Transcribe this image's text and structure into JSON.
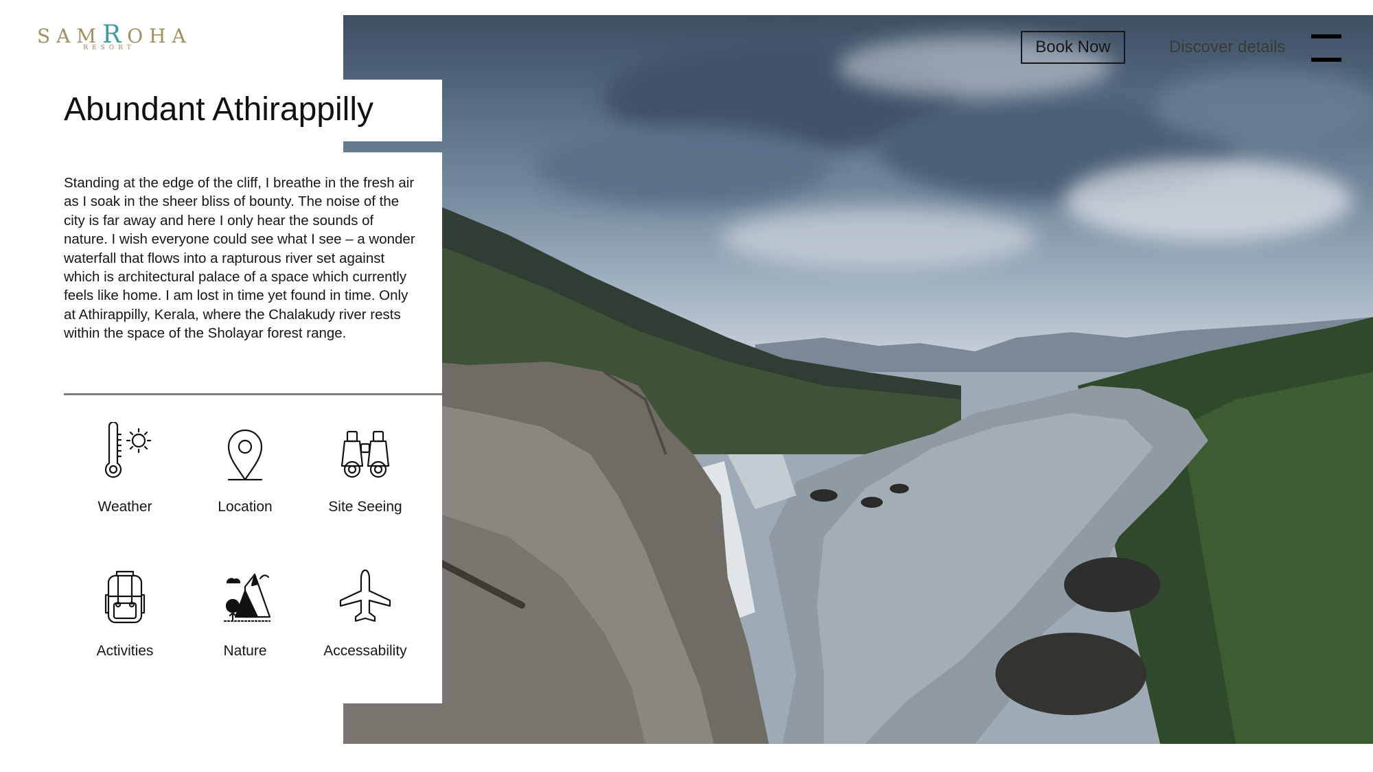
{
  "brand": {
    "logo_main_pre": "SAM",
    "logo_main_accent": "R",
    "logo_main_post": "OHA",
    "logo_sub": "RESORT",
    "colors": {
      "gold": "#a38e5e",
      "teal": "#3b9aa6"
    }
  },
  "header": {
    "book_label": "Book Now",
    "discover_label": "Discover details",
    "menu_icon": "hamburger-icon"
  },
  "content": {
    "title": "Abundant Athirappilly",
    "intro": "Standing at the edge of the cliff, I breathe in the fresh air as I soak in the sheer bliss of bounty. The noise of the city is far away and here I only hear the sounds of nature. I wish everyone could see what I see – a wonder waterfall that flows into a rapturous river set against which is architectural palace of a space which currently feels like home. I am lost in time yet found in time. Only at Athirappilly, Kerala, where the Chalakudy river rests within the space of the Sholayar forest range."
  },
  "features": [
    {
      "label": "Weather",
      "icon": "thermometer-sun-icon"
    },
    {
      "label": "Location",
      "icon": "map-pin-icon"
    },
    {
      "label": "Site Seeing",
      "icon": "binoculars-icon"
    },
    {
      "label": "Activities",
      "icon": "backpack-icon"
    },
    {
      "label": "Nature",
      "icon": "mountains-icon"
    },
    {
      "label": "Accessability",
      "icon": "airplane-icon"
    }
  ]
}
